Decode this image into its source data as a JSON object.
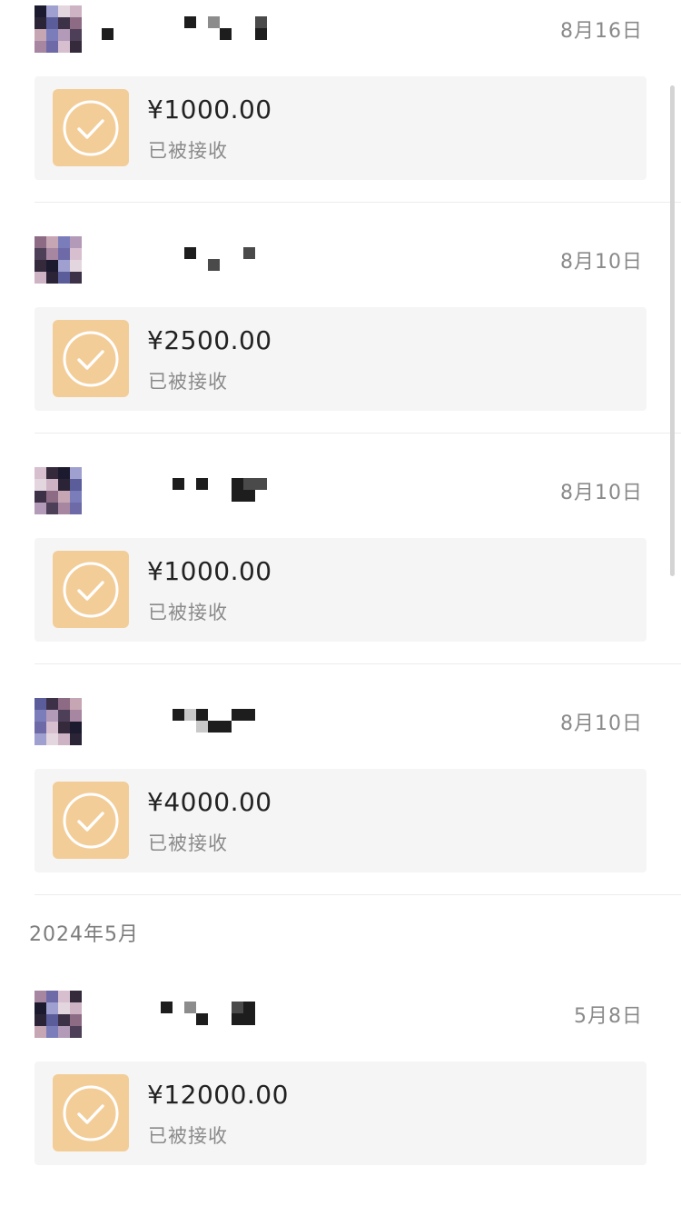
{
  "section_header": "2024年5月",
  "entries": [
    {
      "date": "8月16日",
      "amount": "¥1000.00",
      "status": "已被接收"
    },
    {
      "date": "8月10日",
      "amount": "¥2500.00",
      "status": "已被接收"
    },
    {
      "date": "8月10日",
      "amount": "¥1000.00",
      "status": "已被接收"
    },
    {
      "date": "8月10日",
      "amount": "¥4000.00",
      "status": "已被接收"
    },
    {
      "date": "5月8日",
      "amount": "¥12000.00",
      "status": "已被接收"
    }
  ],
  "icons": {
    "transfer_status": "check-circle-icon"
  },
  "colors": {
    "transfer_tile": "#f3cd98",
    "card_background": "#f5f5f5",
    "muted_text": "#8a8a8a"
  }
}
